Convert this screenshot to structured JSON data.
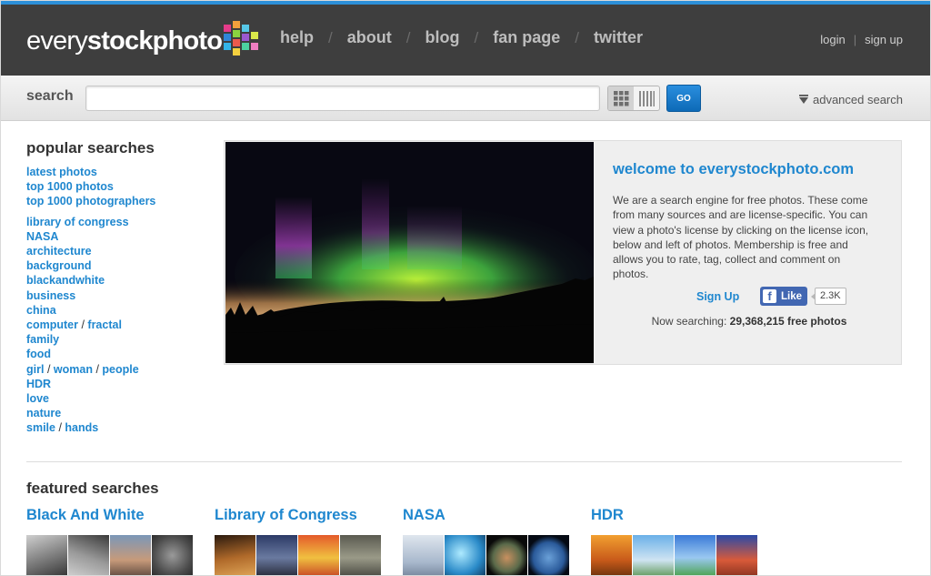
{
  "header": {
    "logo_thin": "every",
    "logo_bold": "stockphoto",
    "nav": [
      "help",
      "about",
      "blog",
      "fan page",
      "twitter"
    ],
    "nav_separator": "/",
    "login": "login",
    "signup": "sign up",
    "auth_separator": "|"
  },
  "search": {
    "label": "search",
    "value": "",
    "go_label": "GO",
    "advanced_label": "advanced search"
  },
  "popular": {
    "title": "popular searches",
    "group1": [
      "latest photos",
      "top 1000 photos",
      "top 1000 photographers"
    ],
    "group2": [
      "library of congress",
      "NASA",
      "architecture",
      "background",
      "blackandwhite",
      "business",
      "china"
    ],
    "computer_fractal": [
      "computer",
      "fractal"
    ],
    "group3": [
      "family",
      "food"
    ],
    "girl_woman_people": [
      "girl",
      "woman",
      "people"
    ],
    "group4": [
      "HDR",
      "love",
      "nature"
    ],
    "smile_hands": [
      "smile",
      "hands"
    ],
    "slash": "/"
  },
  "welcome": {
    "title": "welcome to everystockphoto.com",
    "body": "We are a search engine for free photos. These come from many sources and are license-specific. You can view a photo's license by clicking on the license icon, below and left of photos. Membership is free and allows you to rate, tag, collect and comment on photos.",
    "signup_label": "Sign Up",
    "fb_like_label": "Like",
    "fb_count": "2.3K",
    "now_searching_prefix": "Now searching:",
    "now_searching_count": "29,368,215 free photos"
  },
  "featured": {
    "title": "featured searches",
    "items": [
      {
        "title": "Black And White"
      },
      {
        "title": "Library of Congress"
      },
      {
        "title": "NASA"
      },
      {
        "title": "HDR"
      }
    ]
  },
  "colors": {
    "link_blue": "#1f87cf",
    "header_bg": "#3e3e3e",
    "header_accent": "#2c8fd8",
    "go_button": "#1a7dcc"
  }
}
